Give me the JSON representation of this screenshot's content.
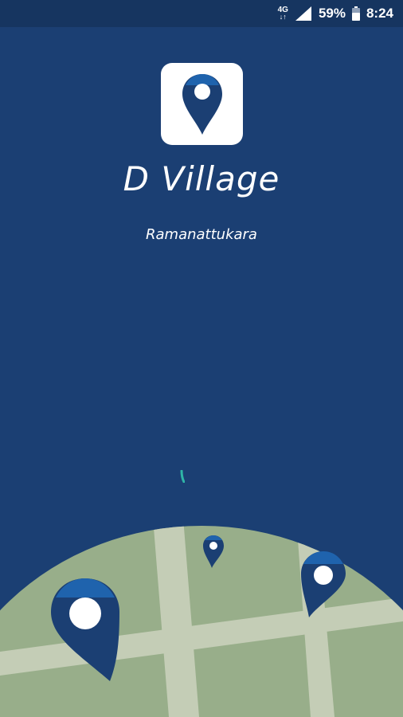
{
  "status_bar": {
    "network_type": "4G",
    "network_arrows": "↓↑",
    "battery_percent": "59%",
    "time": "8:24",
    "icons": [
      "signal-icon",
      "battery-icon"
    ]
  },
  "splash": {
    "app_name": "D Village",
    "location": "Ramanattukara",
    "logo_icon": "map-pin-icon"
  },
  "colors": {
    "background": "#1b3f73",
    "status_bar": "#163560",
    "pin_dark": "#1b3f73",
    "pin_accent": "#1f63ad",
    "map_green": "#98ae8a",
    "map_road": "#c4cdb6",
    "spinner": "#2fb5a7"
  }
}
